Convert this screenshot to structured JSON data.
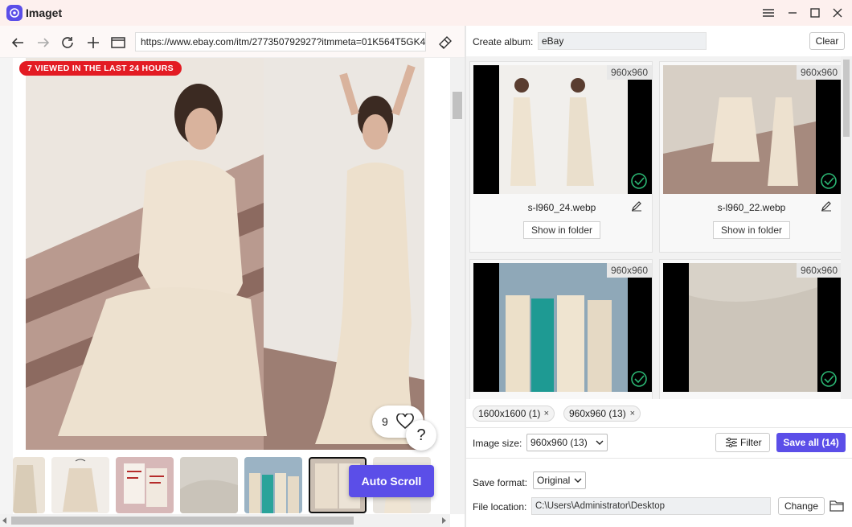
{
  "app": {
    "title": "Imaget"
  },
  "browser": {
    "url": "https://www.ebay.com/itm/277350792927?itmmeta=01K564T5GK4"
  },
  "page": {
    "viewed_badge": "7 VIEWED IN THE LAST 24 HOURS",
    "like_count": "9",
    "help": "?",
    "auto_scroll": "Auto Scroll"
  },
  "panel": {
    "create_album_label": "Create album:",
    "album_name": "eBay",
    "clear_label": "Clear",
    "cards": [
      {
        "dim": "960x960",
        "filename": "s-l960_24.webp",
        "show_folder": "Show in folder"
      },
      {
        "dim": "960x960",
        "filename": "s-l960_22.webp",
        "show_folder": "Show in folder"
      },
      {
        "dim": "960x960"
      },
      {
        "dim": "960x960"
      }
    ],
    "size_tags": [
      {
        "label": "1600x1600 (1)",
        "close": "×"
      },
      {
        "label": "960x960 (13)",
        "close": "×"
      }
    ],
    "image_size_label": "Image size:",
    "image_size_value": "960x960 (13)",
    "filter_label": "Filter",
    "save_all_label": "Save all (14)",
    "save_format_label": "Save format:",
    "save_format_value": "Original",
    "file_location_label": "File location:",
    "file_location_value": "C:\\Users\\Administrator\\Desktop",
    "change_label": "Change"
  },
  "colors": {
    "accent": "#5b4ee8",
    "badge_red": "#e31b23",
    "check_green": "#2bb673"
  }
}
